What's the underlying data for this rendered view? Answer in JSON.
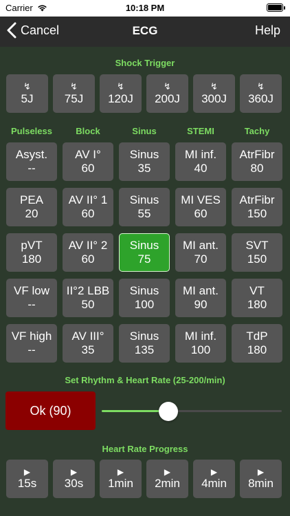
{
  "status": {
    "carrier": "Carrier",
    "time": "10:18 PM"
  },
  "nav": {
    "back_label": "Cancel",
    "title": "ECG",
    "help_label": "Help"
  },
  "shock": {
    "title": "Shock Trigger",
    "icon_glyph": "↯",
    "buttons": [
      "5J",
      "75J",
      "120J",
      "200J",
      "300J",
      "360J"
    ]
  },
  "rhythms": {
    "columns": [
      "Pulseless",
      "Block",
      "Sinus",
      "STEMI",
      "Tachy"
    ],
    "grid": [
      [
        {
          "name": "Asyst.",
          "rate": "--"
        },
        {
          "name": "AV I°",
          "rate": "60"
        },
        {
          "name": "Sinus",
          "rate": "35"
        },
        {
          "name": "MI inf.",
          "rate": "40"
        },
        {
          "name": "AtrFibr",
          "rate": "80"
        }
      ],
      [
        {
          "name": "PEA",
          "rate": "20"
        },
        {
          "name": "AV II° 1",
          "rate": "60"
        },
        {
          "name": "Sinus",
          "rate": "55"
        },
        {
          "name": "MI VES",
          "rate": "60"
        },
        {
          "name": "AtrFibr",
          "rate": "150"
        }
      ],
      [
        {
          "name": "pVT",
          "rate": "180"
        },
        {
          "name": "AV II° 2",
          "rate": "60"
        },
        {
          "name": "Sinus",
          "rate": "75",
          "active": true
        },
        {
          "name": "MI ant.",
          "rate": "70"
        },
        {
          "name": "SVT",
          "rate": "150"
        }
      ],
      [
        {
          "name": "VF low",
          "rate": "--"
        },
        {
          "name": "II°2 LBB",
          "rate": "50"
        },
        {
          "name": "Sinus",
          "rate": "100"
        },
        {
          "name": "MI ant.",
          "rate": "90"
        },
        {
          "name": "VT",
          "rate": "180"
        }
      ],
      [
        {
          "name": "VF high",
          "rate": "--"
        },
        {
          "name": "AV III°",
          "rate": "35"
        },
        {
          "name": "Sinus",
          "rate": "135"
        },
        {
          "name": "MI inf.",
          "rate": "100"
        },
        {
          "name": "TdP",
          "rate": "180"
        }
      ]
    ]
  },
  "rate": {
    "title": "Set Rhythm & Heart Rate (25-200/min)",
    "ok_label": "Ok (90)",
    "value": 90,
    "min": 25,
    "max": 200
  },
  "progress": {
    "title": "Heart Rate Progress",
    "icon_glyph": "▶",
    "buttons": [
      "15s",
      "30s",
      "1min",
      "2min",
      "4min",
      "8min"
    ]
  },
  "colors": {
    "accent": "#7ddc62",
    "active": "#2ea32b",
    "ok_bg": "#8b0000",
    "button_bg": "#555555",
    "background": "#2c3a2c"
  }
}
